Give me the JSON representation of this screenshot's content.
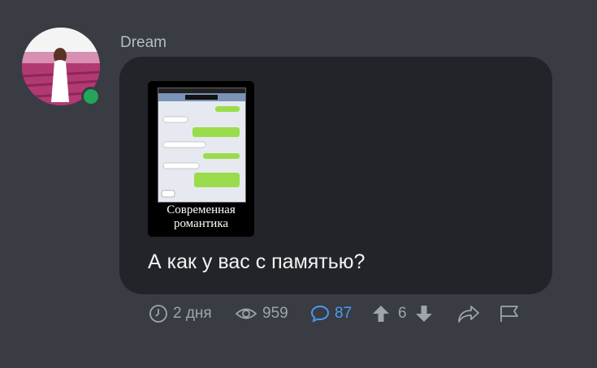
{
  "post": {
    "author": "Dream",
    "status": "online",
    "image_caption_line1": "Современная",
    "image_caption_line2": "романтика",
    "message": "А как у вас с памятью?"
  },
  "stats": {
    "time": "2 дня",
    "views": "959",
    "comments": "87",
    "score": "6"
  },
  "icons": [
    "clock-icon",
    "eye-icon",
    "comment-icon",
    "arrow-up-icon",
    "arrow-down-icon",
    "share-icon",
    "flag-icon"
  ],
  "colors": {
    "background": "#393c43",
    "bubble": "#222429",
    "accent": "#4c9bf0",
    "online": "#23a55a",
    "muted": "#9fa3ab"
  }
}
